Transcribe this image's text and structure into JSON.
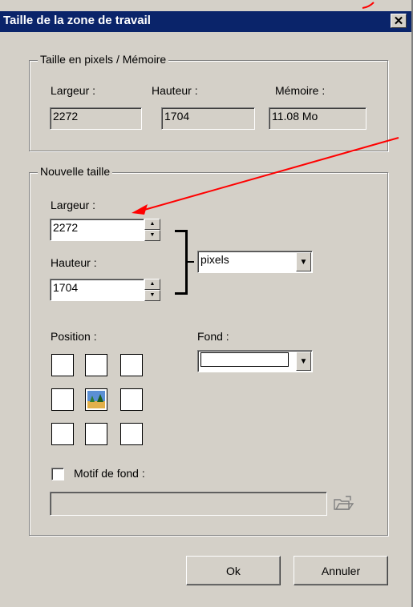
{
  "title": "Taille de la zone de travail",
  "close_label": "✕",
  "current": {
    "legend": "Taille en pixels / Mémoire",
    "width_label": "Largeur :",
    "width_value": "2272",
    "height_label": "Hauteur :",
    "height_value": "1704",
    "memory_label": "Mémoire :",
    "memory_value": "11.08 Mo"
  },
  "new_size": {
    "legend": "Nouvelle taille",
    "width_label": "Largeur :",
    "width_value": "2272",
    "height_label": "Hauteur :",
    "height_value": "1704",
    "unit_value": "pixels",
    "position_label": "Position :",
    "background_label": "Fond :",
    "background_value": "",
    "pattern_label": "Motif de fond :",
    "pattern_path": ""
  },
  "buttons": {
    "ok": "Ok",
    "cancel": "Annuler"
  },
  "annotation_color": "#ff0000"
}
